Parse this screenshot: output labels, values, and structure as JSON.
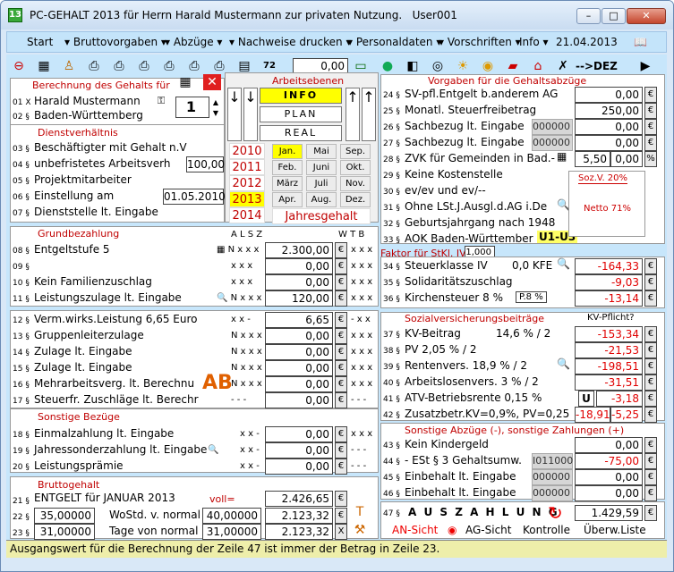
{
  "window": {
    "icon": "13",
    "title": "PC-GEHALT 2013 für Herrn Harald Mustermann zur privaten Nutzung.",
    "user": "User001",
    "min": "–",
    "max": "□",
    "close": "✕"
  },
  "menu": {
    "start": "Start",
    "brutto": "Bruttovorgaben",
    "abzuege": "Abzüge",
    "nachweise": "Nachweise drucken",
    "personal": "Personaldaten",
    "vorschriften": "Vorschriften",
    "info": "Info",
    "date": "21.04.2013"
  },
  "toolbar": {
    "counter": "0,00",
    "dez": "-->DEZ"
  },
  "left": {
    "berechnung_hd": "Berechnung des Gehalts für",
    "name": "Harald Mustermann",
    "land": "Baden-Württemberg",
    "month_no": "1",
    "dienst_hd": "Dienstverhältnis",
    "dienst": [
      "Beschäftigter mit Gehalt n.V",
      "unbefristetes Arbeitsverh",
      "Projektmitarbeiter",
      "Einstellung am",
      "Dienststelle lt. Eingabe"
    ],
    "hours": "100,00",
    "einstellung": "01.05.2010",
    "grund_hd": "Grundbezahlung",
    "cols1": "A L S Z",
    "cols2": "W T B",
    "grund": [
      {
        "label": "Entgeltstufe 5",
        "v": "2.300,00"
      },
      {
        "label": "",
        "v": "0,00"
      },
      {
        "label": "Kein Familienzuschlag",
        "v": "0,00"
      },
      {
        "label": "Leistungszulage lt. Eingabe",
        "v": "120,00"
      }
    ],
    "verm": [
      {
        "label": "Verm.wirks.Leistung   6,65 Euro",
        "v": "6,65"
      },
      {
        "label": "Gruppenleiterzulage",
        "v": "0,00"
      },
      {
        "label": "Zulage lt. Eingabe",
        "v": "0,00"
      },
      {
        "label": "Zulage lt. Eingabe",
        "v": "0,00"
      },
      {
        "label": "Mehrarbeitsverg. lt. Berechnu",
        "v": "0,00"
      },
      {
        "label": "Steuerfr. Zuschläge lt. Berechr",
        "v": "0,00"
      }
    ],
    "sonst_hd": "Sonstige Bezüge",
    "sonst": [
      {
        "label": "Einmalzahlung lt. Eingabe",
        "v": "0,00"
      },
      {
        "label": "Jahressonderzahlung lt. Eingabe",
        "v": "0,00"
      },
      {
        "label": "Leistungsprämie",
        "v": "0,00"
      }
    ],
    "brutto_hd": "Bruttogehalt",
    "brutto_label": "ENTGELT für JANUAR  2013",
    "voll": "voll=",
    "brutto1": "2.426,65",
    "brutto2": "2.123,32",
    "brutto3": "2.123,32",
    "woStd_label": "WoStd. v. normal",
    "woStd": "35,00000",
    "woStd_norm": "40,00000",
    "tage_label": "Tage von normal",
    "tage": "31,00000",
    "tage_norm": "31,00000"
  },
  "ebenen": {
    "hd": "Arbeitsebenen",
    "info": "INFO",
    "plan": "PLAN",
    "real": "REAL",
    "years": [
      "2010",
      "2011",
      "2012",
      "2013",
      "2014"
    ],
    "months": [
      "Jan.",
      "Mai",
      "Sep.",
      "Feb.",
      "Juni",
      "Okt.",
      "März",
      "Juli",
      "Nov.",
      "Apr.",
      "Aug.",
      "Dez."
    ],
    "jahresgehalt": "Jahresgehalt"
  },
  "right": {
    "vorgaben_hd": "Vorgaben für die Gehaltsabzüge",
    "vorgaben": [
      {
        "label": "SV-pfl.Entgelt b.anderem AG",
        "v": "0,00"
      },
      {
        "label": "Monatl. Steuerfreibetrag",
        "v": "250,00"
      },
      {
        "label": "Sachbezug lt. Eingabe",
        "g": "000000",
        "v": "0,00"
      },
      {
        "label": "Sachbezug lt. Eingabe",
        "g": "000000",
        "v": "0,00"
      },
      {
        "label": "ZVK für Gemeinden in Bad.-",
        "v": "5,50",
        "p": "0,00"
      },
      {
        "label": "Keine Kostenstelle",
        "v": ""
      },
      {
        "label": "ev/ev und ev/--",
        "v": ""
      },
      {
        "label": "Ohne LSt.J.Ausgl.d.AG i.De",
        "v": ""
      },
      {
        "label": "Geburtsjahrgang nach 1948",
        "v": ""
      },
      {
        "label": "AOK Baden-Württember",
        "v": "U1-U3"
      }
    ],
    "popup": {
      "sozv": "Soz.V. 20%",
      "netto": "Netto  71%"
    },
    "faktor_label": "Faktor für StKl. IV:",
    "faktor": "1,000",
    "steuer": [
      {
        "label": "Steuerklasse IV",
        "extra": "0,0 KFE",
        "v": "-164,33"
      },
      {
        "label": "Solidaritätszuschlag",
        "v": "-9,03"
      },
      {
        "label": "Kirchensteuer 8 %",
        "extra": "P.8 %",
        "v": "-13,14"
      }
    ],
    "sv_hd": "Sozialversicherungsbeiträge",
    "kv_pflicht": "KV-Pflicht?",
    "sv": [
      {
        "label": "KV-Beitrag",
        "extra": "14,6 % / 2",
        "v": "-153,34"
      },
      {
        "label": "PV 2,05 % / 2",
        "v": "-21,53"
      },
      {
        "label": "Rentenvers. 18,9 % / 2",
        "v": "-198,51"
      },
      {
        "label": "Arbeitslosenvers. 3 % / 2",
        "v": "-31,51"
      },
      {
        "label": "ATV-Betriebsrente 0,15 %",
        "extra": "U",
        "v": "-3,18"
      },
      {
        "label": "Zusatzbetr.KV=0,9%, PV=0,25",
        "v": "-18,91",
        "v2": "-5,25"
      }
    ],
    "sonst_hd": "Sonstige Abzüge (-), sonstige Zahlungen (+)",
    "sonst": [
      {
        "label": "Kein Kindergeld",
        "v": "0,00"
      },
      {
        "label": "- ESt § 3 Gehaltsumw.",
        "g": "I011000",
        "v": "-75,00"
      },
      {
        "label": "Einbehalt lt. Eingabe",
        "g": "000000",
        "v": "0,00"
      },
      {
        "label": "Einbehalt lt. Eingabe",
        "g": "000000",
        "v": "0,00"
      }
    ],
    "auszahlung": "A U S Z A H L U N G",
    "auszahlung_v": "1.429,59",
    "an_sicht": "AN-Sicht",
    "ag_sicht": "AG-Sicht",
    "kontrolle": "Kontrolle",
    "ueberw": "Überw.Liste"
  },
  "status": "Ausgangswert für die Berechnung der Zeile 47 ist immer der Betrag in Zeile 23."
}
